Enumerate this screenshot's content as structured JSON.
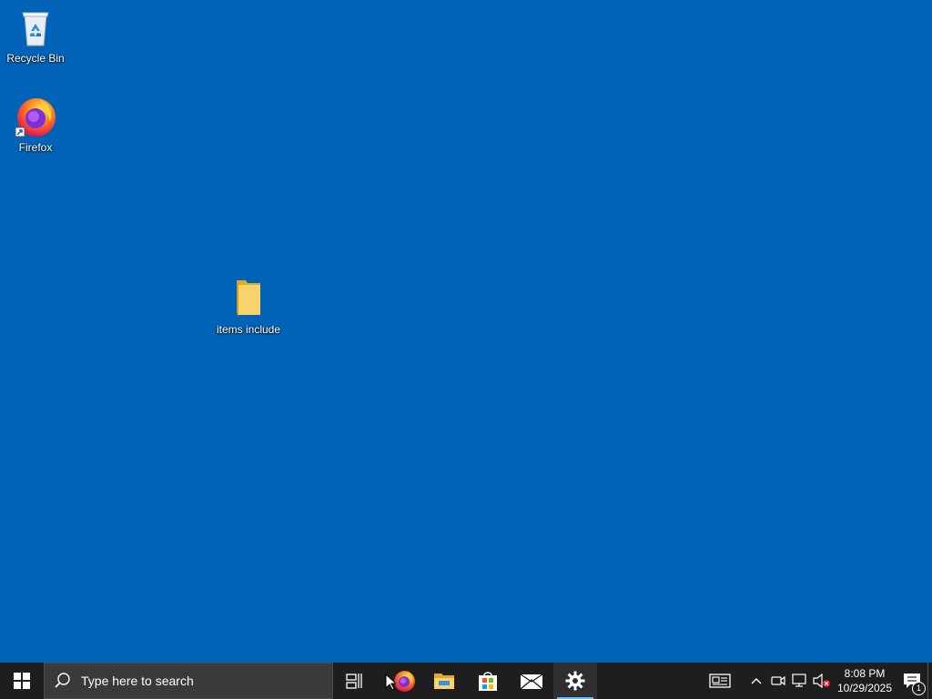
{
  "desktop": {
    "background_color": "#0063b8",
    "icons": [
      {
        "label": "Recycle Bin",
        "icon": "recycle-bin-icon"
      },
      {
        "label": "Firefox",
        "icon": "firefox-icon"
      },
      {
        "label": "items include",
        "icon": "folder-icon"
      }
    ]
  },
  "taskbar": {
    "background_color": "#1e1e1e",
    "search": {
      "placeholder": "Type here to search"
    },
    "pinned": [
      {
        "name": "Task View",
        "icon": "task-view-icon"
      },
      {
        "name": "Firefox",
        "icon": "firefox-icon"
      },
      {
        "name": "File Explorer",
        "icon": "file-explorer-icon"
      },
      {
        "name": "Microsoft Store",
        "icon": "store-icon"
      },
      {
        "name": "Mail",
        "icon": "mail-icon"
      },
      {
        "name": "Settings",
        "icon": "settings-icon",
        "active": true
      }
    ],
    "tray": {
      "clock_time": "8:08 PM",
      "clock_date": "10/29/2025",
      "notification_count": "1"
    }
  }
}
